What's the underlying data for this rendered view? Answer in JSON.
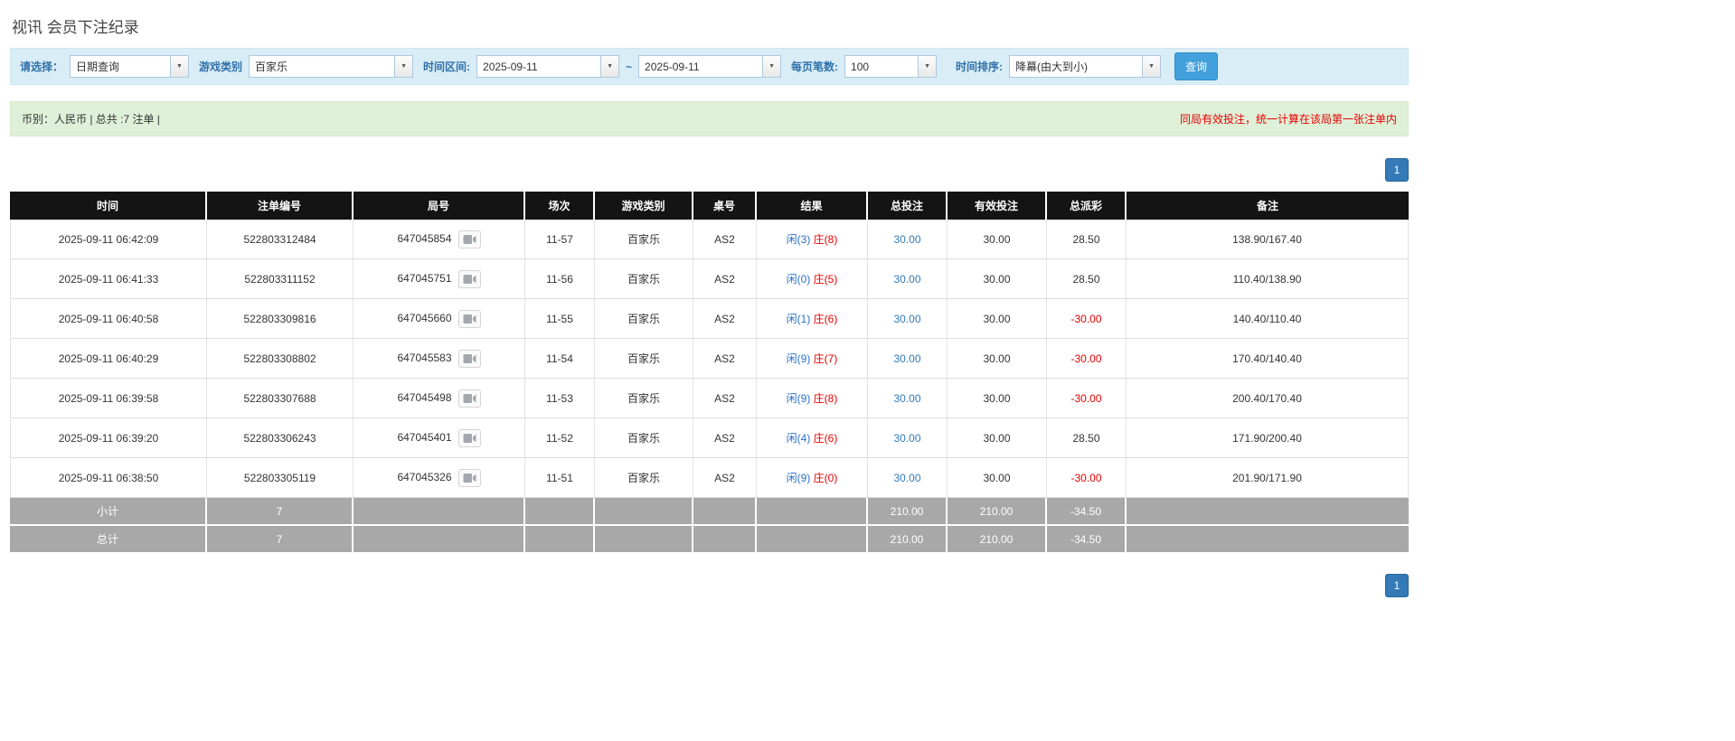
{
  "page": {
    "title": "视讯 会员下注纪录"
  },
  "filters": {
    "select_label": "请选择：",
    "select_value": "日期查询",
    "game_type_label": "游戏类别",
    "game_type_value": "百家乐",
    "date_range_label": "时间区间:",
    "date_from": "2025-09-11",
    "date_separator": "~",
    "date_to": "2025-09-11",
    "page_size_label": "每页笔数:",
    "page_size_value": "100",
    "sort_label": "时间排序:",
    "sort_value": "降幕(由大到小)",
    "search_button": "查询"
  },
  "summary": {
    "left": "币别：人民币 | 总共 :7 注单 |",
    "right": "同局有效投注，统一计算在该局第一张注单内"
  },
  "pagination": {
    "page": "1"
  },
  "table": {
    "headers": [
      "时间",
      "注单编号",
      "局号",
      "场次",
      "游戏类别",
      "桌号",
      "结果",
      "总投注",
      "有效投注",
      "总派彩",
      "备注"
    ],
    "rows": [
      {
        "time": "2025-09-11 06:42:09",
        "bet_id": "522803312484",
        "round_id": "647045854",
        "session": "11-57",
        "game": "百家乐",
        "table_no": "AS2",
        "result_player": "闲(3)",
        "result_banker": "庄(8)",
        "total_bet": "30.00",
        "valid_bet": "30.00",
        "payout": "28.50",
        "remark": "138.90/167.40"
      },
      {
        "time": "2025-09-11 06:41:33",
        "bet_id": "522803311152",
        "round_id": "647045751",
        "session": "11-56",
        "game": "百家乐",
        "table_no": "AS2",
        "result_player": "闲(0)",
        "result_banker": "庄(5)",
        "total_bet": "30.00",
        "valid_bet": "30.00",
        "payout": "28.50",
        "remark": "110.40/138.90"
      },
      {
        "time": "2025-09-11 06:40:58",
        "bet_id": "522803309816",
        "round_id": "647045660",
        "session": "11-55",
        "game": "百家乐",
        "table_no": "AS2",
        "result_player": "闲(1)",
        "result_banker": "庄(6)",
        "total_bet": "30.00",
        "valid_bet": "30.00",
        "payout": "-30.00",
        "remark": "140.40/110.40"
      },
      {
        "time": "2025-09-11 06:40:29",
        "bet_id": "522803308802",
        "round_id": "647045583",
        "session": "11-54",
        "game": "百家乐",
        "table_no": "AS2",
        "result_player": "闲(9)",
        "result_banker": "庄(7)",
        "total_bet": "30.00",
        "valid_bet": "30.00",
        "payout": "-30.00",
        "remark": "170.40/140.40"
      },
      {
        "time": "2025-09-11 06:39:58",
        "bet_id": "522803307688",
        "round_id": "647045498",
        "session": "11-53",
        "game": "百家乐",
        "table_no": "AS2",
        "result_player": "闲(9)",
        "result_banker": "庄(8)",
        "total_bet": "30.00",
        "valid_bet": "30.00",
        "payout": "-30.00",
        "remark": "200.40/170.40"
      },
      {
        "time": "2025-09-11 06:39:20",
        "bet_id": "522803306243",
        "round_id": "647045401",
        "session": "11-52",
        "game": "百家乐",
        "table_no": "AS2",
        "result_player": "闲(4)",
        "result_banker": "庄(6)",
        "total_bet": "30.00",
        "valid_bet": "30.00",
        "payout": "28.50",
        "remark": "171.90/200.40"
      },
      {
        "time": "2025-09-11 06:38:50",
        "bet_id": "522803305119",
        "round_id": "647045326",
        "session": "11-51",
        "game": "百家乐",
        "table_no": "AS2",
        "result_player": "闲(9)",
        "result_banker": "庄(0)",
        "total_bet": "30.00",
        "valid_bet": "30.00",
        "payout": "-30.00",
        "remark": "201.90/171.90"
      }
    ],
    "subtotal": {
      "label": "小计",
      "count": "7",
      "total_bet": "210.00",
      "valid_bet": "210.00",
      "payout": "-34.50"
    },
    "total": {
      "label": "总计",
      "count": "7",
      "total_bet": "210.00",
      "valid_bet": "210.00",
      "payout": "-34.50"
    }
  }
}
